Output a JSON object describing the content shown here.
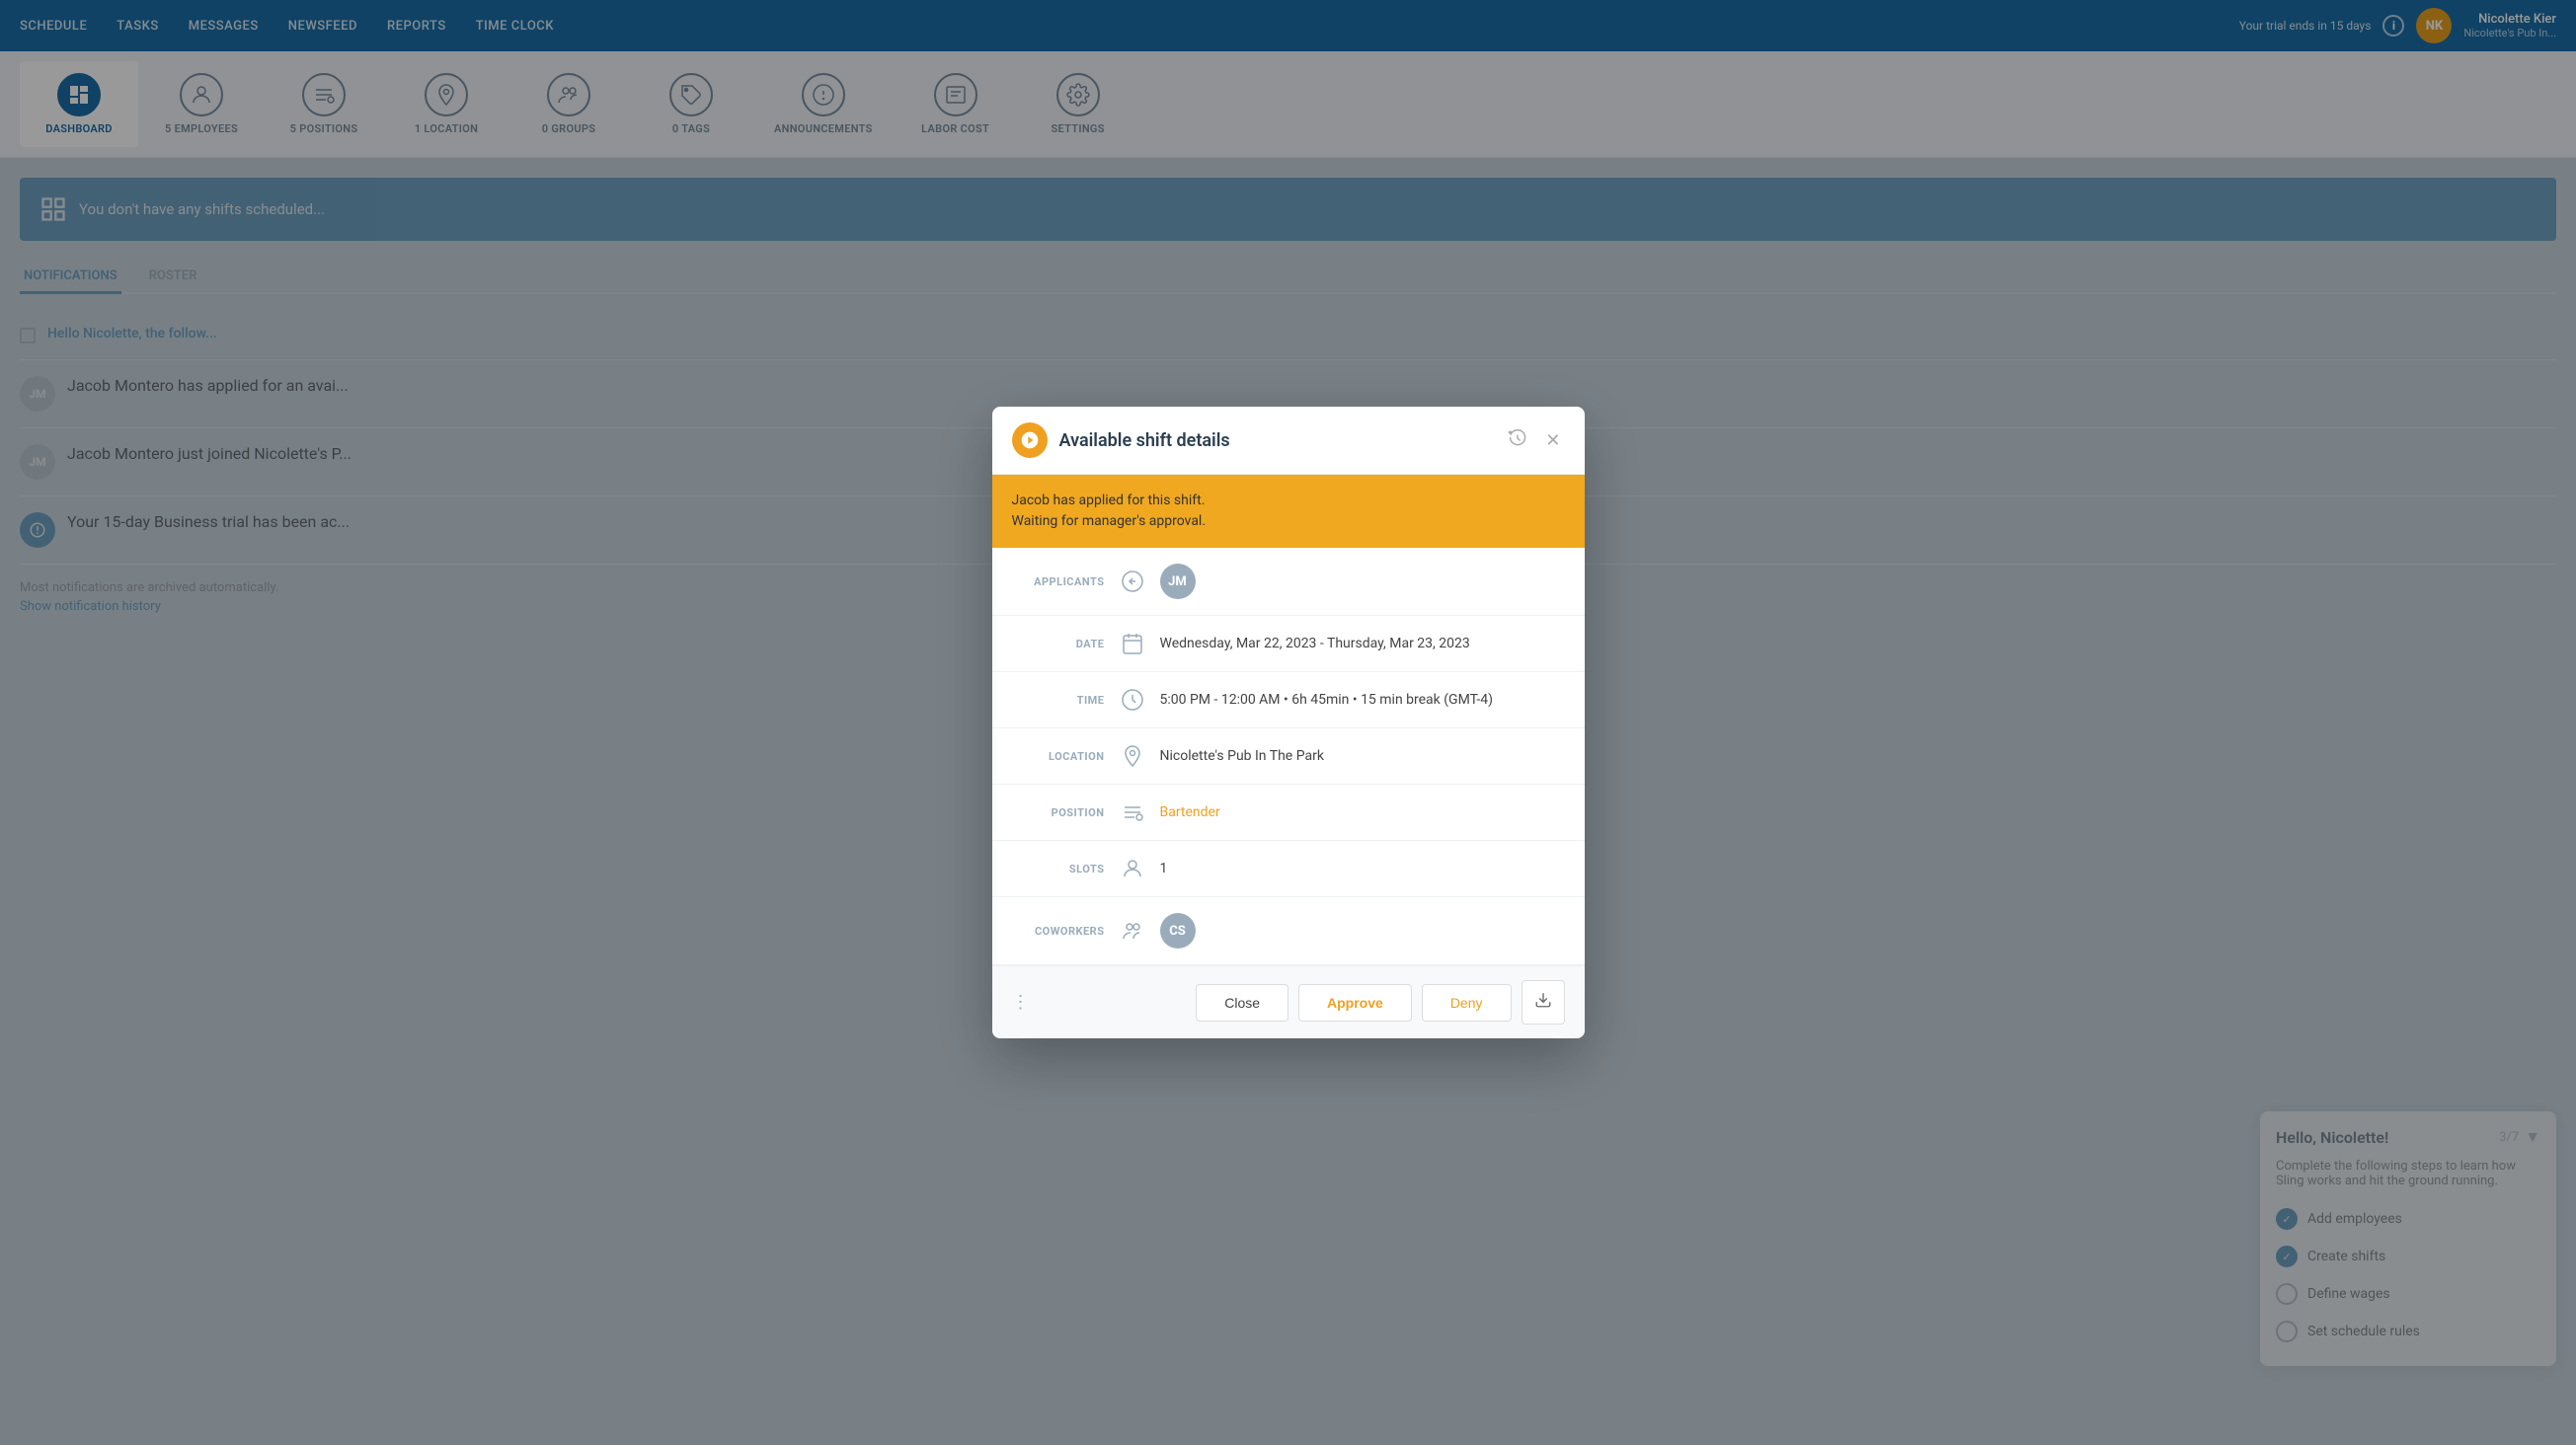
{
  "nav": {
    "links": [
      "SCHEDULE",
      "TASKS",
      "MESSAGES",
      "NEWSFEED",
      "REPORTS",
      "TIME CLOCK"
    ],
    "trial_text": "Your trial ends in 15 days",
    "user_initials": "NK",
    "user_name": "Nicolette Kier",
    "user_pub": "Nicolette's Pub In..."
  },
  "dashboard": {
    "items": [
      {
        "label": "DASHBOARD",
        "icon": "dashboard",
        "count": null,
        "active": true
      },
      {
        "label": "5 EMPLOYEES",
        "icon": "people",
        "count": "5",
        "active": false
      },
      {
        "label": "5 POSITIONS",
        "icon": "list",
        "count": "5",
        "active": false
      },
      {
        "label": "1 LOCATION",
        "icon": "location",
        "count": "1",
        "active": false
      },
      {
        "label": "0 GROUPS",
        "icon": "groups",
        "count": "0",
        "active": false
      },
      {
        "label": "0 TAGS",
        "icon": "tags",
        "count": "0",
        "active": false
      },
      {
        "label": "ANNOUNCEMENTS",
        "icon": "announcements",
        "count": null,
        "active": false
      },
      {
        "label": "LABOR COST",
        "icon": "labor",
        "count": null,
        "active": false
      },
      {
        "label": "SETTINGS",
        "icon": "settings",
        "count": null,
        "active": false
      }
    ]
  },
  "blue_banner": {
    "text": "You don't have any shifts scheduled..."
  },
  "tabs": {
    "items": [
      "NOTIFICATIONS",
      "ROSTER"
    ],
    "active": "NOTIFICATIONS"
  },
  "notifications": {
    "items": [
      {
        "text": "Hello Nicolette, the follow...",
        "checkbox": true
      },
      {
        "initials": "JM",
        "text": "Jacob Montero has applied for an avai..."
      },
      {
        "initials": "JM",
        "text": "Jacob Montero just joined Nicolette's P..."
      },
      {
        "initials": "sling",
        "text": "Your 15-day Business trial has been ac..."
      }
    ],
    "footer": "Most notifications are archived automatically.",
    "history_link": "Show notification history"
  },
  "modal": {
    "title": "Available shift details",
    "warning": {
      "line1": "Jacob has applied for this shift.",
      "line2": "Waiting for manager's approval."
    },
    "rows": {
      "applicants": {
        "label": "APPLICANTS",
        "initials": "JM"
      },
      "date": {
        "label": "DATE",
        "value": "Wednesday, Mar 22, 2023 - Thursday, Mar 23, 2023"
      },
      "time": {
        "label": "TIME",
        "value": "5:00 PM - 12:00 AM • 6h 45min • 15 min break (GMT-4)"
      },
      "location": {
        "label": "LOCATION",
        "value": "Nicolette's Pub In The Park"
      },
      "position": {
        "label": "POSITION",
        "value": "Bartender"
      },
      "slots": {
        "label": "SLOTS",
        "value": "1"
      },
      "coworkers": {
        "label": "COWORKERS",
        "initials": "CS"
      }
    },
    "buttons": {
      "close": "Close",
      "approve": "Approve",
      "deny": "Deny"
    }
  },
  "right_panel": {
    "title": "Hello, Nicolette!",
    "count": "3/7",
    "subtitle": "Complete the following steps to learn how Sling works and hit the ground running.",
    "checklist": [
      {
        "label": "Add employees",
        "done": true
      },
      {
        "label": "Create shifts",
        "done": true
      },
      {
        "label": "Define wages",
        "done": false
      },
      {
        "label": "Set schedule rules",
        "done": false
      }
    ]
  }
}
